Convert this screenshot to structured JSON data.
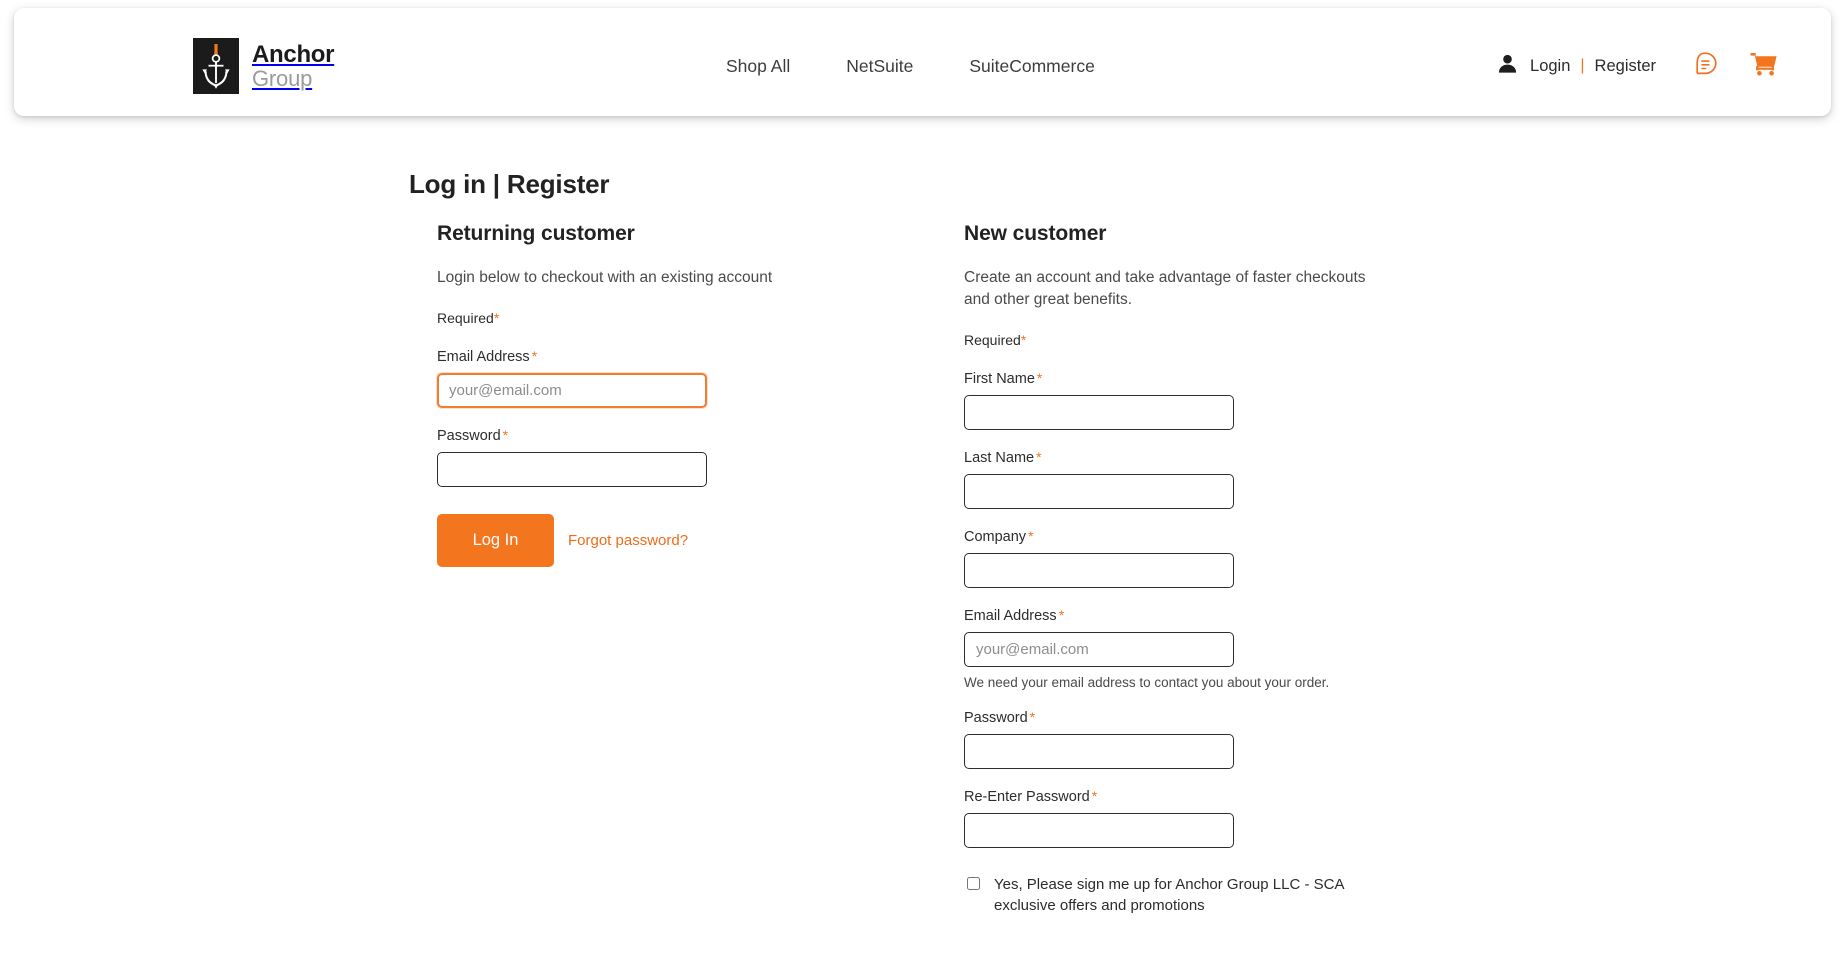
{
  "header": {
    "logo": {
      "icon": "anchor-icon",
      "brand_line1": "Anchor",
      "brand_line2": "Group"
    },
    "nav": [
      {
        "label": "Shop All"
      },
      {
        "label": "NetSuite"
      },
      {
        "label": "SuiteCommerce"
      }
    ],
    "account": {
      "user_icon": "user-icon",
      "login_label": "Login",
      "separator": "|",
      "register_label": "Register",
      "quote_icon": "quote-bubble-icon",
      "cart_icon": "shopping-cart-icon"
    }
  },
  "main": {
    "page_title": "Log in | Register",
    "returning": {
      "heading": "Returning customer",
      "subtitle": "Login below to checkout with an existing account",
      "required_note": "Required",
      "required_star": "*",
      "email": {
        "label": "Email Address",
        "placeholder": "your@email.com",
        "value": ""
      },
      "password": {
        "label": "Password",
        "placeholder": "",
        "value": ""
      },
      "login_button": "Log In",
      "forgot_link": "Forgot password?"
    },
    "new_customer": {
      "heading": "New customer",
      "subtitle": "Create an account and take advantage of faster checkouts and other great benefits.",
      "required_note": "Required",
      "required_star": "*",
      "fields": [
        {
          "label": "First Name",
          "placeholder": "",
          "value": ""
        },
        {
          "label": "Last Name",
          "placeholder": "",
          "value": ""
        },
        {
          "label": "Company",
          "placeholder": "",
          "value": ""
        },
        {
          "label": "Email Address",
          "placeholder": "your@email.com",
          "value": "",
          "help": "We need your email address to contact you about your order."
        },
        {
          "label": "Password",
          "placeholder": "",
          "value": ""
        },
        {
          "label": "Re-Enter Password",
          "placeholder": "",
          "value": ""
        }
      ],
      "newsletter": {
        "checked": false,
        "label": "Yes, Please sign me up for Anchor Group LLC - SCA exclusive offers and promotions"
      }
    }
  },
  "colors": {
    "accent_orange": "#f3751e",
    "link_orange": "#ef6c1a",
    "star_orange": "#f07224",
    "text_dark": "#222222",
    "border_dark": "#2e2e2e"
  }
}
